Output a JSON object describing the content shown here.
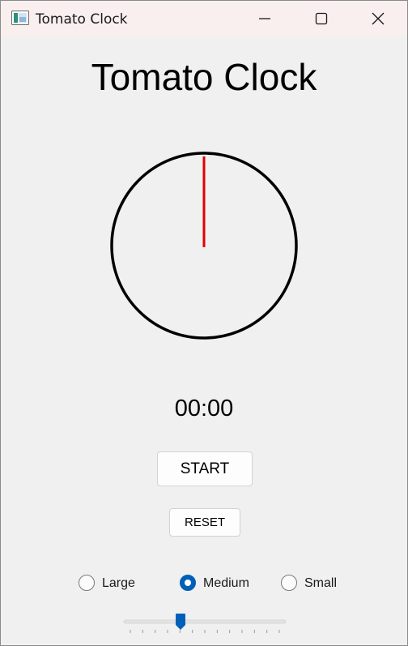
{
  "window": {
    "title": "Tomato Clock",
    "icon": "app-window-icon",
    "controls": [
      "minimize-icon",
      "maximize-icon",
      "close-icon"
    ]
  },
  "app": {
    "heading": "Tomato Clock",
    "time": "00:00",
    "start_label": "START",
    "reset_label": "RESET"
  },
  "clock_face": {
    "hand_color": "#e00000",
    "ring_color": "#000000"
  },
  "size_options": {
    "items": [
      {
        "label": "Large",
        "checked": false
      },
      {
        "label": "Medium",
        "checked": true
      },
      {
        "label": "Small",
        "checked": false
      }
    ]
  },
  "slider": {
    "value_fraction": 0.35,
    "tick_count": 13,
    "accent_color": "#005fb8"
  }
}
